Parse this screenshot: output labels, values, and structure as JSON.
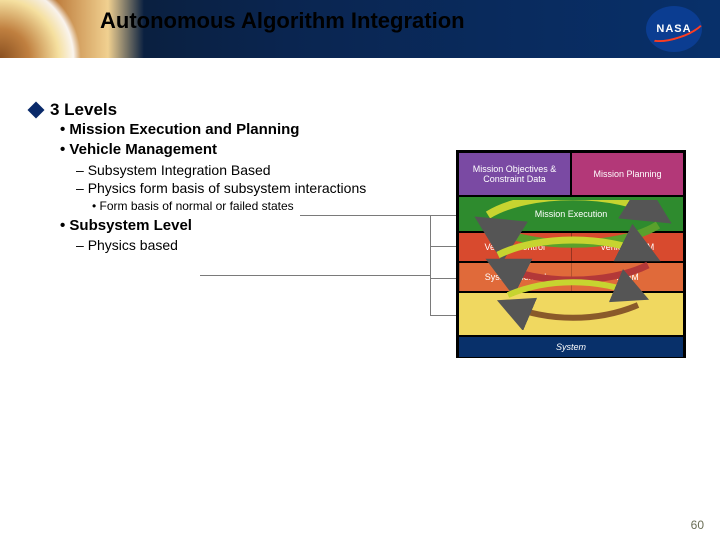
{
  "header": {
    "title": "Autonomous Algorithm Integration",
    "logo_text": "NASA"
  },
  "outline": {
    "h1": "3 Levels",
    "i1": "Mission Execution and Planning",
    "i2": "Vehicle Management",
    "i2a": "Subsystem Integration Based",
    "i2b": "Physics form basis of subsystem interactions",
    "i2b1": "Form basis of normal or failed states",
    "i3": "Subsystem Level",
    "i3a": "Physics based"
  },
  "diagram": {
    "mp_left": "Mission Objectives & Constraint Data",
    "mp_right": "Mission Planning",
    "me": "Mission Execution",
    "vc_left": "Vehicle Control",
    "vc_right": "Vehicle ISHM",
    "sc_left": "System Control",
    "sc_right": "ISHM",
    "system": "System"
  },
  "page_number": "60"
}
